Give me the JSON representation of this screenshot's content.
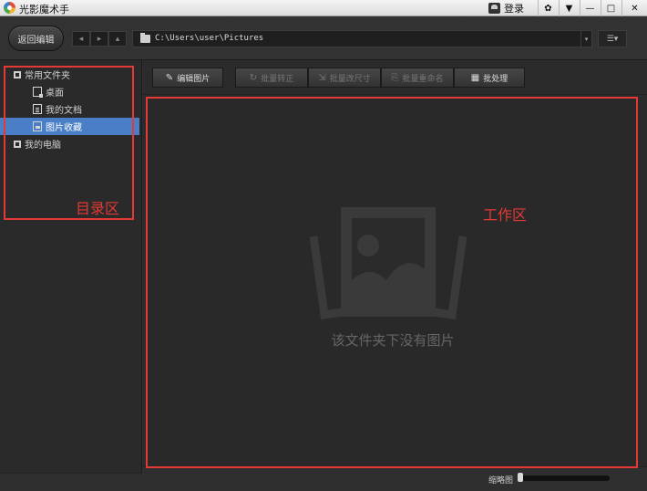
{
  "app": {
    "title": "光影魔术手",
    "login_label": "登录"
  },
  "title_buttons": {
    "skin_glyph": "✿",
    "menu_glyph": "▼",
    "min_glyph": "—",
    "max_glyph": "□",
    "close_glyph": "✕"
  },
  "toolbar": {
    "back_label": "返回编辑",
    "back_glyph": "◂",
    "forward_glyph": "▸",
    "up_glyph": "▴",
    "path": "C:\\Users\\user\\Pictures",
    "path_drop_glyph": "▾",
    "view_glyph": "☰▾"
  },
  "tree": {
    "items": [
      {
        "label": "常用文件夹"
      },
      {
        "label": "桌面"
      },
      {
        "label": "我的文档"
      },
      {
        "label": "图片收藏"
      },
      {
        "label": "我的电脑"
      }
    ],
    "selected_index": 3
  },
  "actions": {
    "edit": {
      "label": "编辑图片",
      "glyph": "✎"
    },
    "rotate": {
      "label": "批量转正",
      "glyph": "↻"
    },
    "resize": {
      "label": "批量改尺寸",
      "glyph": "⇲"
    },
    "rename": {
      "label": "批量重命名",
      "glyph": "⎘"
    },
    "batch": {
      "label": "批处理",
      "glyph": "▦"
    }
  },
  "content": {
    "empty_text": "该文件夹下没有图片"
  },
  "annotations": {
    "directory": "目录区",
    "work": "工作区"
  },
  "status": {
    "thumb_label": "缩略图",
    "zoom_fraction": 0.0
  },
  "colors": {
    "annotation_red": "#e53935",
    "selection_blue": "#4a7fc8"
  }
}
